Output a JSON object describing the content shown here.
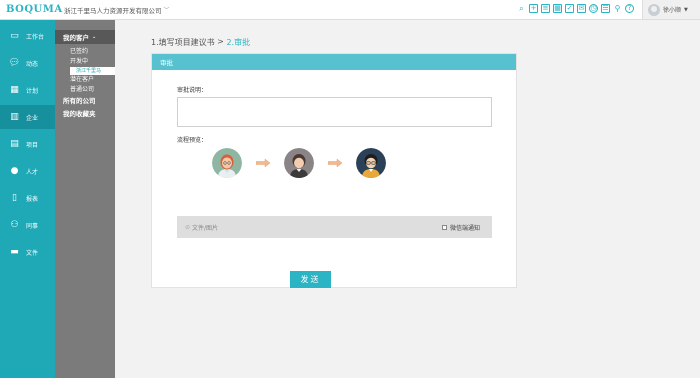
{
  "header": {
    "logo": "BOQUMA",
    "company": "浙江千里马人力资源开发有限公司",
    "user_name": "徐小顺",
    "icons": [
      "search-icon",
      "plus-icon",
      "doc-icon",
      "calendar-icon",
      "check-icon",
      "mail-icon",
      "alarm-icon",
      "list-icon",
      "location-icon",
      "help-icon"
    ]
  },
  "leftnav": {
    "items": [
      {
        "label": "工作台",
        "icon": "monitor-icon"
      },
      {
        "label": "动态",
        "icon": "chat-icon"
      },
      {
        "label": "计划",
        "icon": "calendar-icon"
      },
      {
        "label": "企业",
        "icon": "building-icon"
      },
      {
        "label": "项目",
        "icon": "project-icon"
      },
      {
        "label": "人才",
        "icon": "person-icon"
      },
      {
        "label": "报表",
        "icon": "report-icon"
      },
      {
        "label": "同事",
        "icon": "colleagues-icon"
      },
      {
        "label": "文件",
        "icon": "folder-icon"
      }
    ],
    "active_index": 3
  },
  "subnav": {
    "title": "我的客户",
    "items": [
      "已签约",
      "开发中",
      "浙江千里马",
      "潜在客户",
      "普通公司"
    ],
    "others": [
      "所有的公司",
      "我的收藏夹"
    ]
  },
  "breadcrumb": {
    "step1": "1.填写项目建议书",
    "sep": " > ",
    "step2": "2.审批"
  },
  "card": {
    "title": "审批",
    "desc_label": "审批说明：",
    "desc_value": "",
    "flow_label": "流程预览：",
    "attach_label": "文件/图片",
    "notify_label": "微信端通知",
    "send_label": "发送"
  },
  "colors": {
    "accent": "#2bb4c4",
    "nav_bg": "#1fa9b7",
    "subnav_bg": "#7b7b7b",
    "card_head": "#58c1cf"
  }
}
